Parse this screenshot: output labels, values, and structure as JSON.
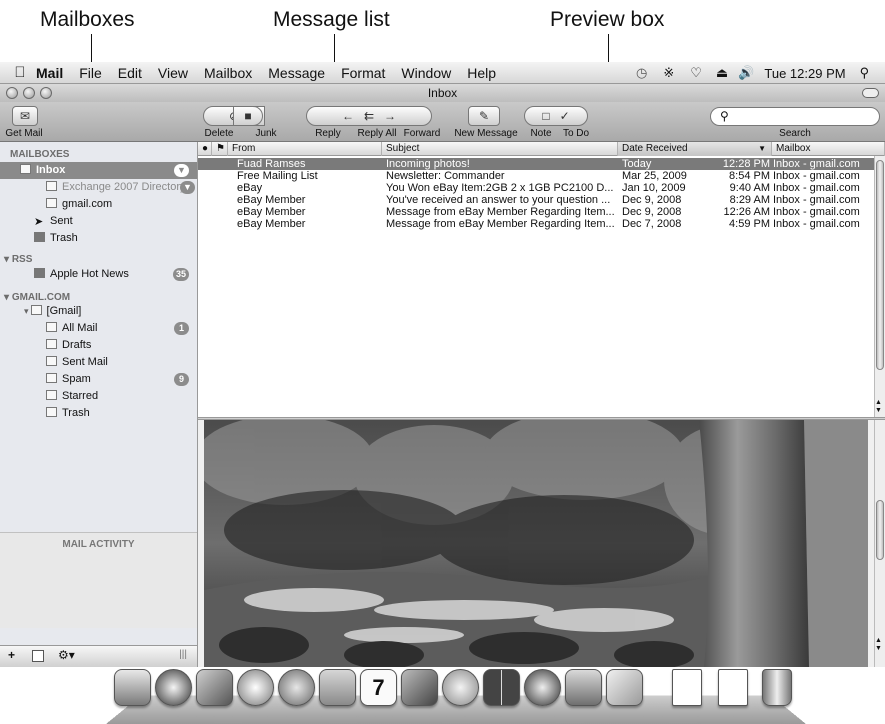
{
  "callouts": [
    "Mailboxes",
    "Message list",
    "Preview box"
  ],
  "menubar": {
    "apple": "apple-icon",
    "app_name": "Mail",
    "items": [
      "File",
      "Edit",
      "View",
      "Mailbox",
      "Message",
      "Format",
      "Window",
      "Help"
    ],
    "clock": "Tue 12:29 PM"
  },
  "window": {
    "title": "Inbox"
  },
  "toolbar": {
    "get_mail": "Get Mail",
    "delete": "Delete",
    "junk": "Junk",
    "reply": "Reply",
    "reply_all": "Reply All",
    "forward": "Forward",
    "new_message": "New Message",
    "note": "Note",
    "todo": "To Do",
    "search_label": "Search",
    "search_icon": "magnifier-icon"
  },
  "sidebar": {
    "mailboxes_header": "MAILBOXES",
    "inbox": "Inbox",
    "exchange": "Exchange 2007 Directory",
    "gmail": "gmail.com",
    "sent": "Sent",
    "trash": "Trash",
    "rss_header": "RSS",
    "apple_hot_news": "Apple Hot News",
    "apple_hot_news_count": "35",
    "gmailcom_header": "GMAIL.COM",
    "gmail_folder": "[Gmail]",
    "all_mail": "All Mail",
    "all_mail_count": "1",
    "drafts": "Drafts",
    "sent_mail": "Sent Mail",
    "spam": "Spam",
    "spam_count": "9",
    "starred": "Starred",
    "gtrash": "Trash",
    "activity": "MAIL ACTIVITY",
    "footer_add": "+",
    "footer_gear": "gear-icon"
  },
  "list": {
    "headers": {
      "from": "From",
      "subject": "Subject",
      "date": "Date Received",
      "mailbox": "Mailbox"
    },
    "rows": [
      {
        "from": "Fuad Ramses",
        "subject": "Incoming photos!",
        "date": "Today",
        "time": "12:28 PM",
        "mailbox": "Inbox - gmail.com"
      },
      {
        "from": "Free Mailing List",
        "subject": "Newsletter: Commander",
        "date": "Mar 25, 2009",
        "time": "8:54 PM",
        "mailbox": "Inbox - gmail.com"
      },
      {
        "from": "eBay",
        "subject": "You Won eBay Item:2GB 2 x 1GB PC2100 D...",
        "date": "Jan 10, 2009",
        "time": "9:40 AM",
        "mailbox": "Inbox - gmail.com"
      },
      {
        "from": "eBay Member",
        "subject": "You've received an answer to your question ...",
        "date": "Dec 9, 2008",
        "time": "8:29 AM",
        "mailbox": "Inbox - gmail.com"
      },
      {
        "from": "eBay Member",
        "subject": "Message from eBay Member Regarding Item...",
        "date": "Dec 9, 2008",
        "time": "12:26 AM",
        "mailbox": "Inbox - gmail.com"
      },
      {
        "from": "eBay Member",
        "subject": "Message from eBay Member Regarding Item...",
        "date": "Dec 7, 2008",
        "time": "4:59 PM",
        "mailbox": "Inbox - gmail.com"
      }
    ]
  },
  "preview": {
    "image": "forest-stream-photo"
  },
  "dock": {
    "icons": [
      "finder-icon",
      "dashboard-icon",
      "mail-icon",
      "safari-icon",
      "ichat-icon",
      "address-book-icon",
      "ical-icon",
      "iphoto-icon",
      "itunes-icon",
      "spaces-icon",
      "time-machine-icon",
      "system-preferences-icon",
      "preview-icon",
      "pdf-document-icon",
      "pdf-document-icon",
      "trash-icon"
    ]
  }
}
